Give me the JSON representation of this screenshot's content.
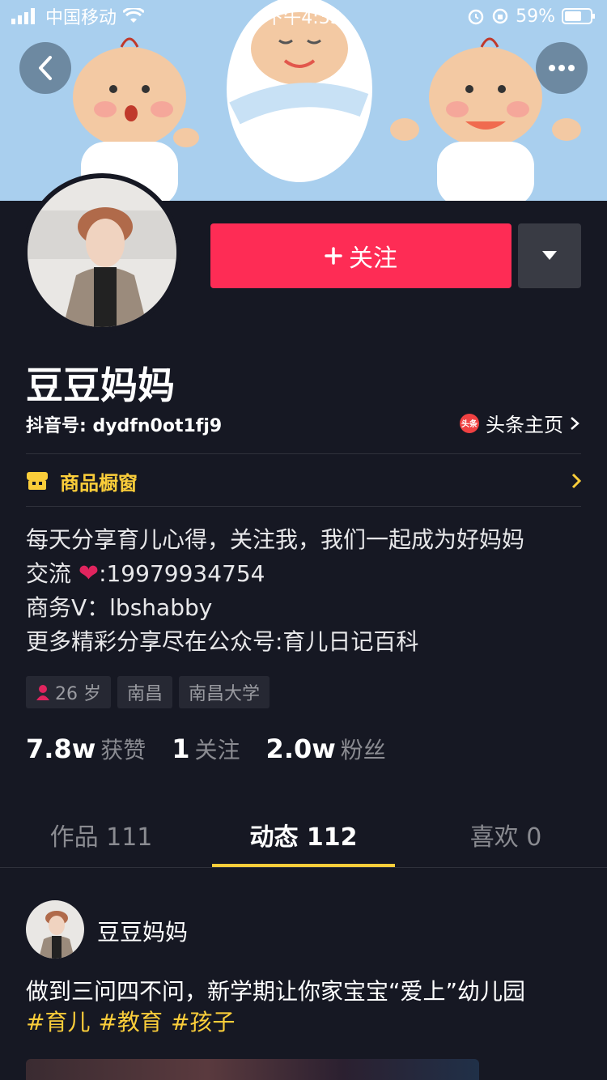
{
  "status_bar": {
    "carrier": "中国移动",
    "time": "下午4:35",
    "battery": "59%"
  },
  "profile": {
    "follow_label": "关注",
    "nickname": "豆豆妈妈",
    "douyin_id": "抖音号: dydfn0ot1fj9",
    "toutiao_link": "头条主页",
    "toutiao_logo_text": "头条",
    "shop_label": "商品橱窗",
    "bio": [
      "每天分享育儿心得，关注我，我们一起成为好妈妈",
      "交流",
      ":19979934754",
      "商务V：lbshabby",
      "更多精彩分享尽在公众号:育儿日记百科"
    ],
    "tags": [
      "26 岁",
      "南昌",
      "南昌大学"
    ],
    "stats": [
      {
        "num": "7.8w",
        "label": "获赞"
      },
      {
        "num": "1",
        "label": "关注"
      },
      {
        "num": "2.0w",
        "label": "粉丝"
      }
    ]
  },
  "tabs": [
    {
      "label": "作品 111",
      "active": false
    },
    {
      "label": "动态 112",
      "active": true
    },
    {
      "label": "喜欢 0",
      "active": false
    }
  ],
  "post": {
    "author": "豆豆妈妈",
    "text": "做到三问四不问，新学期让你家宝宝“爱上”幼儿园",
    "hashtags": [
      "#育儿",
      "#教育",
      "#孩子"
    ]
  },
  "colors": {
    "accent_red": "#fe2c55",
    "accent_yellow": "#facd3a",
    "background": "#161823"
  }
}
